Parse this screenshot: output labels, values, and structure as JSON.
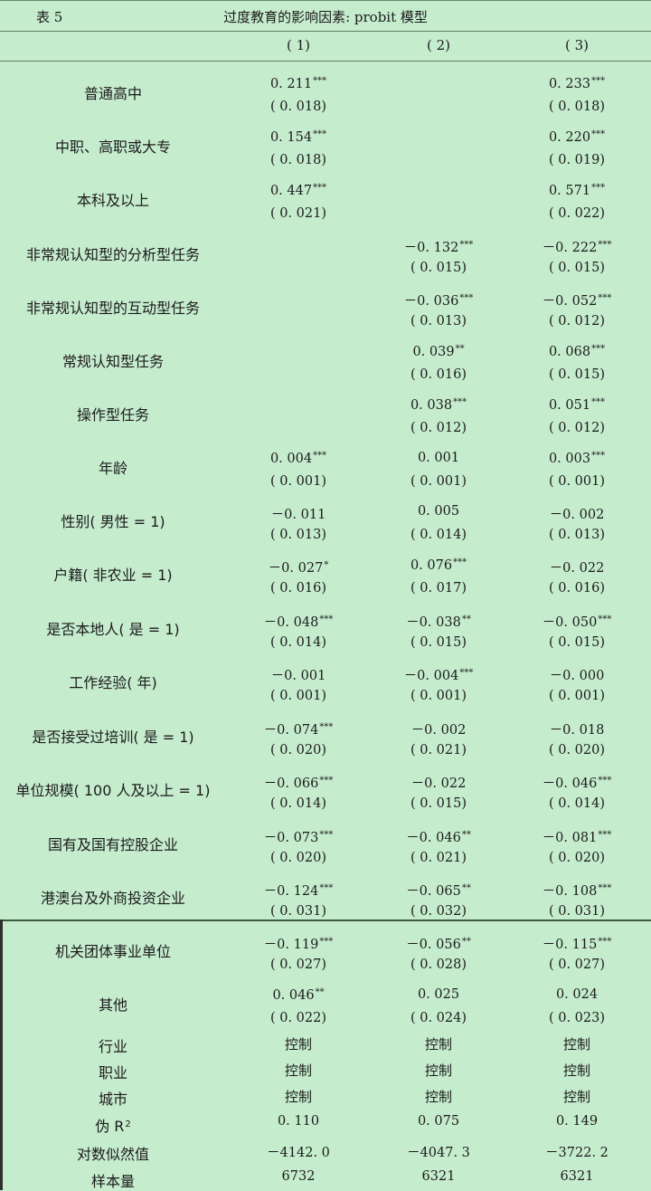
{
  "header": {
    "table_no": "表 5",
    "title": "过度教育的影响因素: probit 模型",
    "columns": [
      "( 1)",
      "( 2)",
      "( 3)"
    ]
  },
  "rows": [
    {
      "label": "普通高中",
      "cells": [
        {
          "coef": "0. 211",
          "stars": "***",
          "se": "( 0. 018)"
        },
        {
          "coef": "",
          "stars": "",
          "se": ""
        },
        {
          "coef": "0. 233",
          "stars": "***",
          "se": "( 0. 018)"
        }
      ]
    },
    {
      "label": "中职、高职或大专",
      "cells": [
        {
          "coef": "0. 154",
          "stars": "***",
          "se": "( 0. 018)"
        },
        {
          "coef": "",
          "stars": "",
          "se": ""
        },
        {
          "coef": "0. 220",
          "stars": "***",
          "se": "( 0. 019)"
        }
      ]
    },
    {
      "label": "本科及以上",
      "cells": [
        {
          "coef": "0. 447",
          "stars": "***",
          "se": "( 0. 021)"
        },
        {
          "coef": "",
          "stars": "",
          "se": ""
        },
        {
          "coef": "0. 571",
          "stars": "***",
          "se": "( 0. 022)"
        }
      ]
    },
    {
      "label": "非常规认知型的分析型任务",
      "cells": [
        {
          "coef": "",
          "stars": "",
          "se": ""
        },
        {
          "coef": "－0. 132",
          "stars": "***",
          "se": "( 0. 015)"
        },
        {
          "coef": "－0. 222",
          "stars": "***",
          "se": "( 0. 015)"
        }
      ]
    },
    {
      "label": "非常规认知型的互动型任务",
      "cells": [
        {
          "coef": "",
          "stars": "",
          "se": ""
        },
        {
          "coef": "－0. 036",
          "stars": "***",
          "se": "( 0. 013)"
        },
        {
          "coef": "－0. 052",
          "stars": "***",
          "se": "( 0. 012)"
        }
      ]
    },
    {
      "label": "常规认知型任务",
      "cells": [
        {
          "coef": "",
          "stars": "",
          "se": ""
        },
        {
          "coef": "0. 039",
          "stars": "**",
          "se": "( 0. 016)"
        },
        {
          "coef": "0. 068",
          "stars": "***",
          "se": "( 0. 015)"
        }
      ]
    },
    {
      "label": "操作型任务",
      "cells": [
        {
          "coef": "",
          "stars": "",
          "se": ""
        },
        {
          "coef": "0. 038",
          "stars": "***",
          "se": "( 0. 012)"
        },
        {
          "coef": "0. 051",
          "stars": "***",
          "se": "( 0. 012)"
        }
      ]
    },
    {
      "label": "年龄",
      "cells": [
        {
          "coef": "0. 004",
          "stars": "***",
          "se": "( 0. 001)"
        },
        {
          "coef": "0. 001",
          "stars": "",
          "se": "( 0. 001)"
        },
        {
          "coef": "0. 003",
          "stars": "***",
          "se": "( 0. 001)"
        }
      ]
    },
    {
      "label": "性别( 男性 = 1)",
      "cells": [
        {
          "coef": "－0. 011",
          "stars": "",
          "se": "( 0. 013)"
        },
        {
          "coef": "0. 005",
          "stars": "",
          "se": "( 0. 014)"
        },
        {
          "coef": "－0. 002",
          "stars": "",
          "se": "( 0. 013)"
        }
      ]
    },
    {
      "label": "户籍( 非农业 = 1)",
      "cells": [
        {
          "coef": "－0. 027",
          "stars": "*",
          "se": "( 0. 016)"
        },
        {
          "coef": "0. 076",
          "stars": "***",
          "se": "( 0. 017)"
        },
        {
          "coef": "－0. 022",
          "stars": "",
          "se": "( 0. 016)"
        }
      ]
    },
    {
      "label": "是否本地人( 是 = 1)",
      "cells": [
        {
          "coef": "－0. 048",
          "stars": "***",
          "se": "( 0. 014)"
        },
        {
          "coef": "－0. 038",
          "stars": "**",
          "se": "( 0. 015)"
        },
        {
          "coef": "－0. 050",
          "stars": "***",
          "se": "( 0. 015)"
        }
      ]
    },
    {
      "label": "工作经验( 年)",
      "cells": [
        {
          "coef": "－0. 001",
          "stars": "",
          "se": "( 0. 001)"
        },
        {
          "coef": "－0. 004",
          "stars": "***",
          "se": "( 0. 001)"
        },
        {
          "coef": "－0. 000",
          "stars": "",
          "se": "( 0. 001)"
        }
      ]
    },
    {
      "label": "是否接受过培训( 是 = 1)",
      "cells": [
        {
          "coef": "－0. 074",
          "stars": "***",
          "se": "( 0. 020)"
        },
        {
          "coef": "－0. 002",
          "stars": "",
          "se": "( 0. 021)"
        },
        {
          "coef": "－0. 018",
          "stars": "",
          "se": "( 0. 020)"
        }
      ]
    },
    {
      "label": "单位规模( 100 人及以上 = 1)",
      "cells": [
        {
          "coef": "－0. 066",
          "stars": "***",
          "se": "( 0. 014)"
        },
        {
          "coef": "－0. 022",
          "stars": "",
          "se": "( 0. 015)"
        },
        {
          "coef": "－0. 046",
          "stars": "***",
          "se": "( 0. 014)"
        }
      ]
    },
    {
      "label": "国有及国有控股企业",
      "cells": [
        {
          "coef": "－0. 073",
          "stars": "***",
          "se": "( 0. 020)"
        },
        {
          "coef": "－0. 046",
          "stars": "**",
          "se": "( 0. 021)"
        },
        {
          "coef": "－0. 081",
          "stars": "***",
          "se": "( 0. 020)"
        }
      ]
    },
    {
      "label": "港澳台及外商投资企业",
      "cells": [
        {
          "coef": "－0. 124",
          "stars": "***",
          "se": "( 0. 031)"
        },
        {
          "coef": "－0. 065",
          "stars": "**",
          "se": "( 0. 032)"
        },
        {
          "coef": "－0. 108",
          "stars": "***",
          "se": "( 0. 031)"
        }
      ]
    },
    {
      "label": "机关团体事业单位",
      "cells": [
        {
          "coef": "－0. 119",
          "stars": "***",
          "se": "( 0. 027)"
        },
        {
          "coef": "－0. 056",
          "stars": "**",
          "se": "( 0. 028)"
        },
        {
          "coef": "－0. 115",
          "stars": "***",
          "se": "( 0. 027)"
        }
      ]
    },
    {
      "label": "其他",
      "cells": [
        {
          "coef": "0. 046",
          "stars": "**",
          "se": "( 0. 022)"
        },
        {
          "coef": "0. 025",
          "stars": "",
          "se": "( 0. 024)"
        },
        {
          "coef": "0. 024",
          "stars": "",
          "se": "( 0. 023)"
        }
      ]
    }
  ],
  "summary_rows": [
    {
      "label": "行业",
      "values": [
        "控制",
        "控制",
        "控制"
      ],
      "kind": "text"
    },
    {
      "label": "职业",
      "values": [
        "控制",
        "控制",
        "控制"
      ],
      "kind": "text"
    },
    {
      "label": "城市",
      "values": [
        "控制",
        "控制",
        "控制"
      ],
      "kind": "text"
    },
    {
      "label": "伪 R",
      "label_sup": "2",
      "values": [
        "0. 110",
        "0. 075",
        "0. 149"
      ],
      "kind": "num"
    },
    {
      "label": "对数似然值",
      "values": [
        "－4142. 0",
        "－4047. 3",
        "－3722. 2"
      ],
      "kind": "num"
    },
    {
      "label": "样本量",
      "values": [
        "6732",
        "6321",
        "6321"
      ],
      "kind": "num"
    }
  ]
}
